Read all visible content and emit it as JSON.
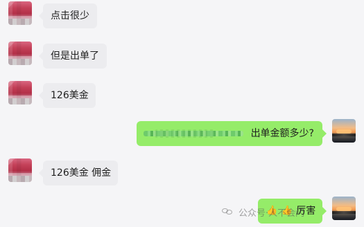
{
  "messages": [
    {
      "side": "left",
      "text": "点击很少"
    },
    {
      "side": "left",
      "text": "但是出单了"
    },
    {
      "side": "left",
      "text": "126美金"
    },
    {
      "side": "right",
      "text": "出单金额多少?"
    },
    {
      "side": "left",
      "text": "126美金 佣金"
    },
    {
      "side": "right",
      "text": "厉害",
      "prefix_icons": [
        "thumbs-up-icon",
        "thumbs-up-icon"
      ]
    }
  ],
  "watermark": {
    "text": "公众号·人不会闪"
  }
}
